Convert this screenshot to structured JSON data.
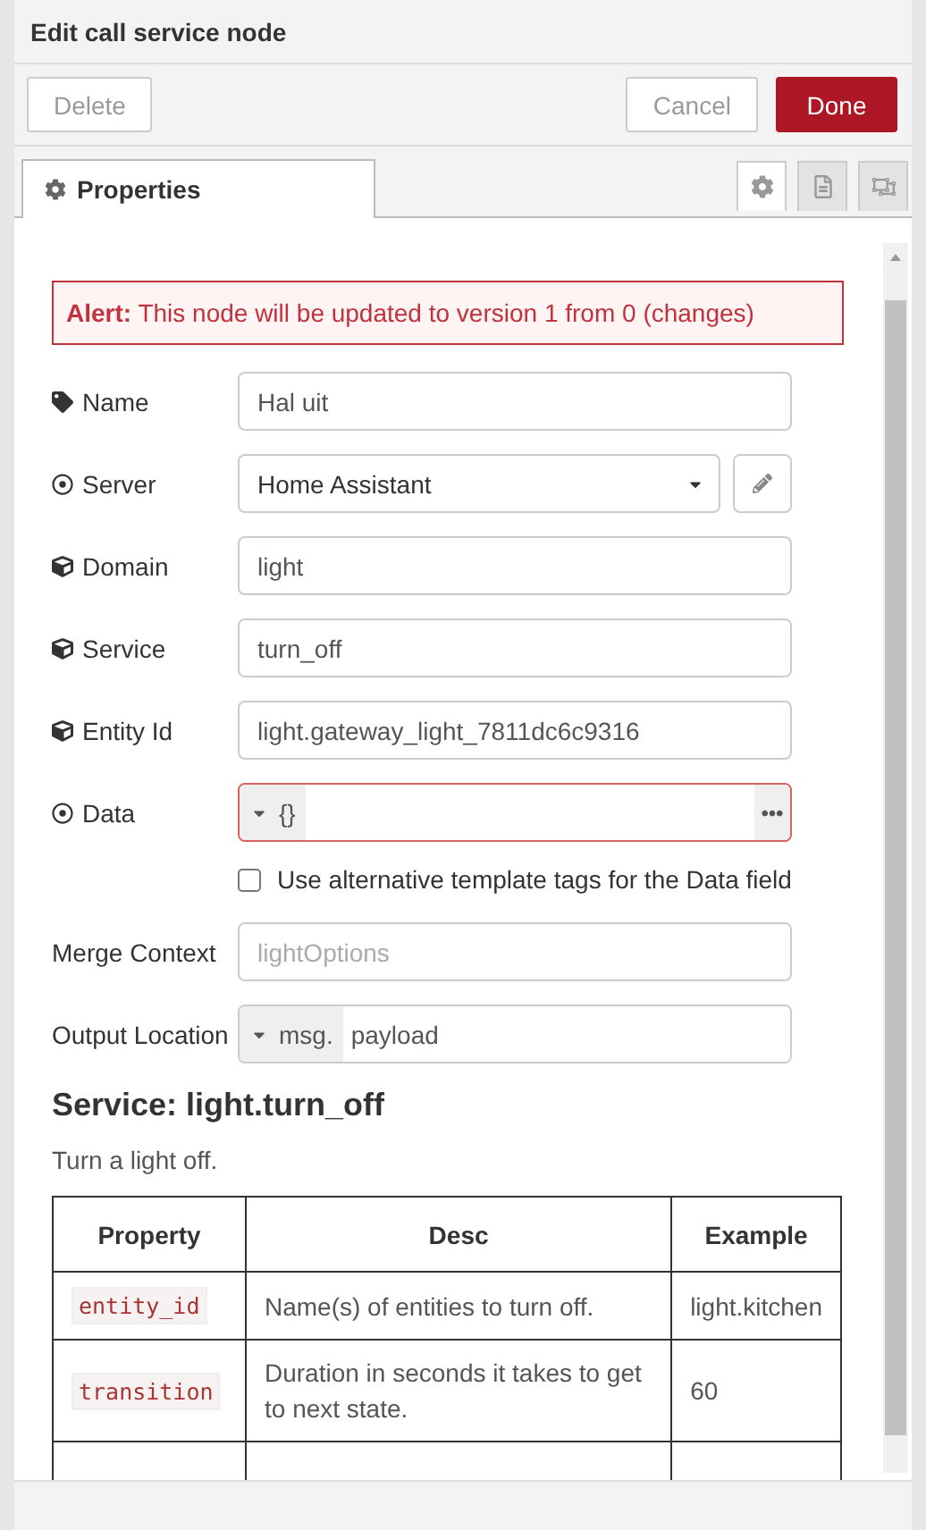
{
  "tray": {
    "title": "Edit call service node"
  },
  "buttons": [
    {
      "label": "Delete",
      "kind": "plain"
    },
    {
      "label": "Cancel",
      "kind": "plain"
    },
    {
      "label": "Done",
      "kind": "primary"
    }
  ],
  "tabs": [
    {
      "label": "Properties",
      "selected": true
    }
  ],
  "tab_icons": [
    {
      "selected": true
    },
    {
      "selected": false
    },
    {
      "selected": false
    }
  ],
  "alert": {
    "label": "Alert:",
    "text": "This node will be updated to version 1 from 0 (changes)"
  },
  "fields": [
    {
      "kind": "text",
      "label": "Name",
      "value": "Hal uit"
    },
    {
      "kind": "select",
      "label": "Server",
      "value": "Home Assistant"
    },
    {
      "kind": "text",
      "label": "Domain",
      "value": "light"
    },
    {
      "kind": "text",
      "label": "Service",
      "value": "turn_off"
    },
    {
      "kind": "text",
      "label": "Entity Id",
      "value": "light.gateway_light_7811dc6c9316"
    },
    {
      "kind": "typed",
      "label": "Data",
      "type": "{}",
      "invalid": true
    },
    {
      "kind": "checkbox",
      "label": "Use alternative template tags for the Data field",
      "checked": false
    },
    {
      "kind": "text",
      "label": "Merge Context",
      "placeholder": "lightOptions"
    },
    {
      "kind": "typed",
      "label": "Output Location",
      "type": "msg.",
      "value": "payload",
      "invalid": false
    }
  ],
  "service": {
    "title": "Service: light.turn_off",
    "description": "Turn a light off.",
    "table": {
      "columns": [
        "Property",
        "Desc",
        "Example"
      ],
      "rows": [
        [
          "entity_id",
          "Name(s) of entities to turn off.",
          "light.kitchen"
        ],
        [
          "transition",
          "Duration in seconds it takes to get to next state.",
          "60"
        ]
      ]
    }
  }
}
